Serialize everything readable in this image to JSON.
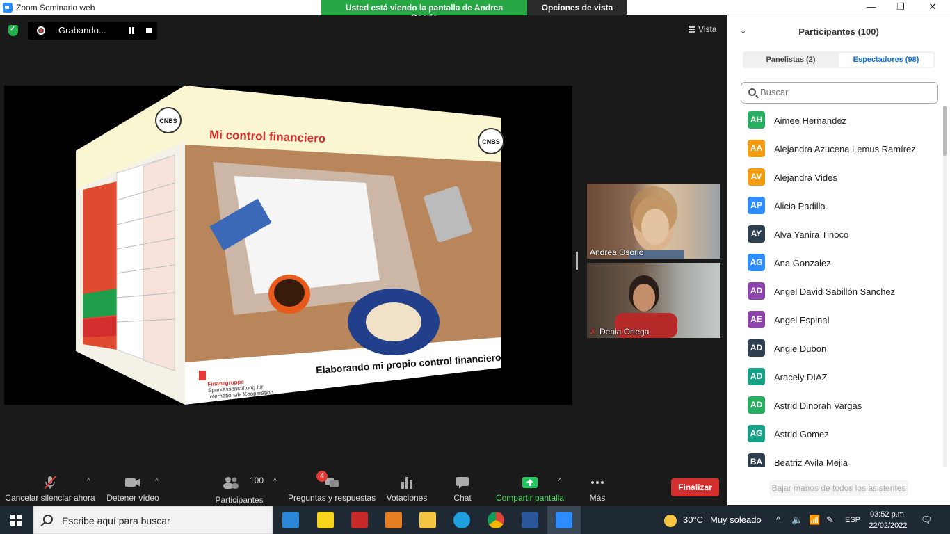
{
  "window": {
    "title": "Zoom Seminario web",
    "minimize": "—",
    "maximize": "❐",
    "close": "✕"
  },
  "banner": {
    "viewing_text": "Usted está viendo la pantalla de Andrea Osorio",
    "view_options": "Opciones de vista ⌄"
  },
  "recording": {
    "label": "Grabando..."
  },
  "view_button": "Vista",
  "shared_slide": {
    "title": "Mi control financiero",
    "subtitle": "Elaborando mi propio control financiero",
    "brand_line1": "Finanzgruppe",
    "brand_line2": "Sparkassenstiftung für",
    "brand_line3": "internationale Kooperation",
    "logo_text": "CNBS"
  },
  "video_tiles": [
    {
      "name": "Andrea Osorio",
      "muted": false
    },
    {
      "name": "Denia Ortega",
      "muted": true
    }
  ],
  "toolbar": {
    "mute_label": "Cancelar silenciar ahora",
    "video_label": "Detener vídeo",
    "participants_label": "Participantes",
    "participants_count": "100",
    "qa_label": "Preguntas y respuestas",
    "qa_badge": "4",
    "polls_label": "Votaciones",
    "chat_label": "Chat",
    "share_label": "Compartir pantalla",
    "more_label": "Más",
    "end_label": "Finalizar"
  },
  "panel": {
    "title": "Participantes (100)",
    "tab_panelists": "Panelistas (2)",
    "tab_attendees": "Espectadores (98)",
    "search_placeholder": "Buscar",
    "lower_hands": "Bajar manos de todos los asistentes",
    "attendees": [
      {
        "initials": "AH",
        "name": "Aimee Hernandez",
        "color": "#27ae60"
      },
      {
        "initials": "AA",
        "name": "Alejandra Azucena Lemus Ramírez",
        "color": "#f39c12"
      },
      {
        "initials": "AV",
        "name": "Alejandra Vides",
        "color": "#f39c12"
      },
      {
        "initials": "AP",
        "name": "Alicia Padilla",
        "color": "#2d8cff"
      },
      {
        "initials": "AY",
        "name": "Alva Yanira Tinoco",
        "color": "#2c3e50"
      },
      {
        "initials": "AG",
        "name": "Ana Gonzalez",
        "color": "#2d8cff"
      },
      {
        "initials": "AD",
        "name": "Angel David Sabillón Sanchez",
        "color": "#8e44ad"
      },
      {
        "initials": "AE",
        "name": "Angel Espinal",
        "color": "#8e44ad"
      },
      {
        "initials": "AD",
        "name": "Angie Dubon",
        "color": "#2c3e50"
      },
      {
        "initials": "AD",
        "name": "Aracely DIAZ",
        "color": "#16a085"
      },
      {
        "initials": "AD",
        "name": "Astrid Dinorah Vargas",
        "color": "#27ae60"
      },
      {
        "initials": "AG",
        "name": "Astrid Gomez",
        "color": "#16a085"
      },
      {
        "initials": "BA",
        "name": "Beatriz Avila Mejia",
        "color": "#2c3e50"
      }
    ]
  },
  "taskbar": {
    "search_placeholder": "Escribe aquí para buscar",
    "temperature": "30°C",
    "weather": "Muy soleado",
    "language": "ESP",
    "time": "03:52 p.m.",
    "date": "22/02/2022"
  }
}
